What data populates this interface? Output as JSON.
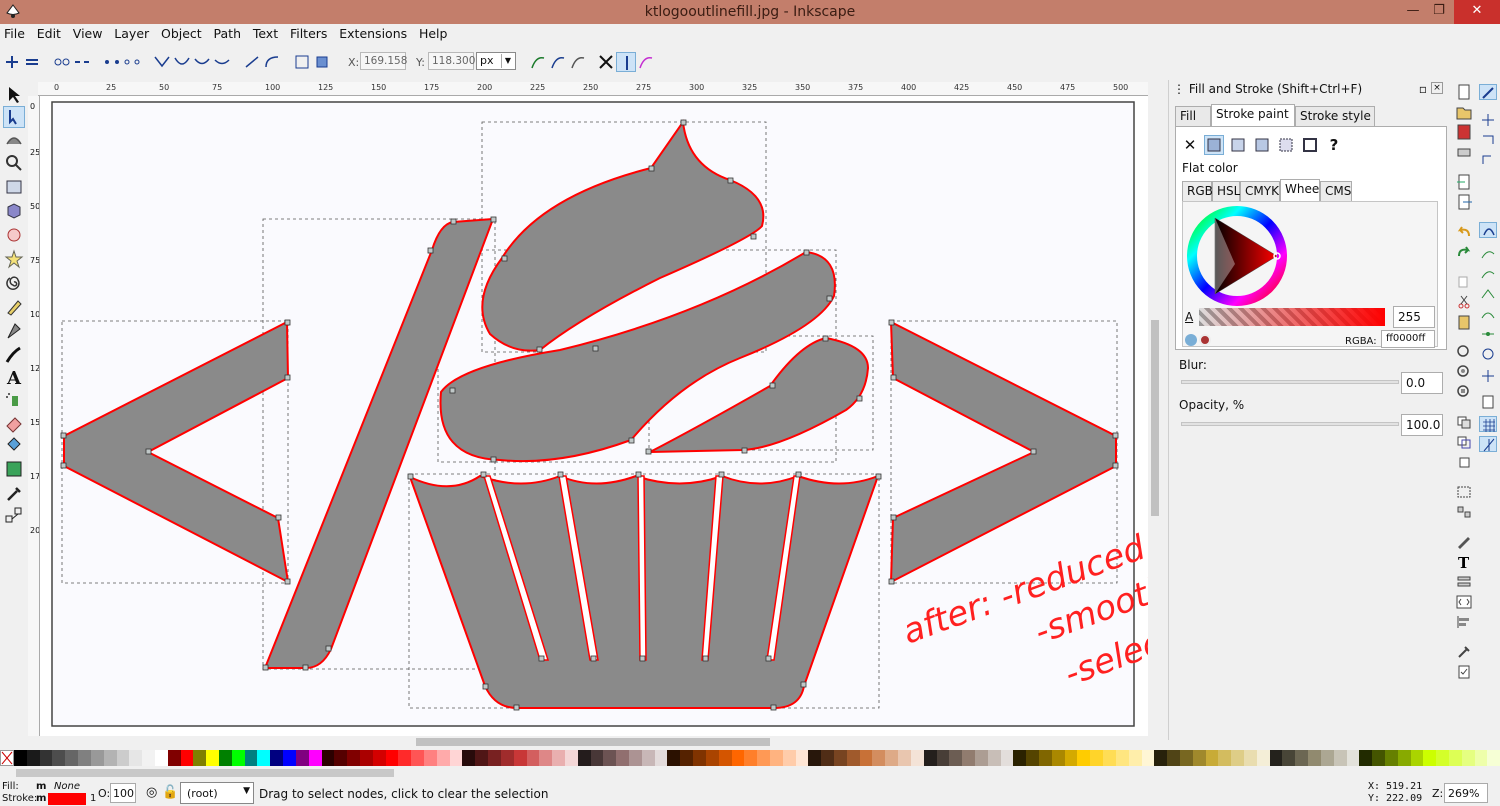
{
  "window": {
    "title": "ktlogooutlinefill.jpg - Inkscape",
    "minimize": "—",
    "maximize": "❐",
    "close": "✕"
  },
  "menu": [
    "File",
    "Edit",
    "View",
    "Layer",
    "Object",
    "Path",
    "Text",
    "Filters",
    "Extensions",
    "Help"
  ],
  "toolcontrols": {
    "x_label": "X:",
    "x_value": "169.158",
    "y_label": "Y:",
    "y_value": "118.300",
    "unit": "px"
  },
  "ruler": {
    "h_ticks": [
      "0",
      "25",
      "50",
      "75",
      "100",
      "125",
      "150",
      "175",
      "200",
      "225",
      "250",
      "275",
      "300",
      "325",
      "350",
      "375",
      "400",
      "425",
      "450",
      "475",
      "500"
    ],
    "v_ticks": [
      "0",
      "25",
      "50",
      "75",
      "100",
      "125",
      "150",
      "175",
      "200"
    ]
  },
  "annotation": {
    "line1": "after: -reduced nodes",
    "line2": "-smooth paths",
    "line3": "-select all"
  },
  "panel": {
    "title": "Fill and Stroke (Shift+Ctrl+F)",
    "tabs": [
      "Fill",
      "Stroke paint",
      "Stroke style"
    ],
    "selected_tab": "Stroke paint",
    "paint_none": "✕",
    "paint_unknown": "?",
    "mode": "Flat color",
    "color_tabs": [
      "RGB",
      "HSL",
      "CMYK",
      "Wheel",
      "CMS"
    ],
    "selected_color_tab": "Wheel",
    "alpha_label": "A",
    "alpha_value": "255",
    "rgba_label": "RGBA:",
    "rgba_value": "ff0000ff",
    "blur_label": "Blur:",
    "blur_value": "0.0",
    "opacity_label": "Opacity, %",
    "opacity_value": "100.0"
  },
  "colors": {
    "stroke": "#ff0000",
    "shape_fill": "#8a8a8a",
    "titlebar": "#c37e6b"
  },
  "status": {
    "fill_label": "Fill:",
    "fill_m": "m",
    "fill_value": "None",
    "stroke_label": "Stroke:",
    "stroke_m": "m",
    "stroke_width": "1",
    "opacity_label": "O:",
    "opacity_value": "100",
    "layer": "(root)",
    "message": "Drag to select nodes, click to clear the selection",
    "x_label": "X:",
    "x_value": "519.21",
    "y_label": "Y:",
    "y_value": "222.09",
    "zoom_label": "Z:",
    "zoom_value": "269%"
  },
  "palette_colors": [
    "#000000",
    "#1a1a1a",
    "#333333",
    "#4d4d4d",
    "#666666",
    "#808080",
    "#999999",
    "#b3b3b3",
    "#cccccc",
    "#e6e6e6",
    "#f2f2f2",
    "#ffffff",
    "#800000",
    "#ff0000",
    "#808000",
    "#ffff00",
    "#008000",
    "#00ff00",
    "#008080",
    "#00ffff",
    "#000080",
    "#0000ff",
    "#800080",
    "#ff00ff",
    "#2b0000",
    "#550000",
    "#800000",
    "#aa0000",
    "#d40000",
    "#ff0000",
    "#ff2a2a",
    "#ff5555",
    "#ff8080",
    "#ffaaaa",
    "#ffd5d5",
    "#280b0b",
    "#501616",
    "#782121",
    "#a02c2c",
    "#c83737",
    "#d35f5f",
    "#de8787",
    "#e9afaf",
    "#f4d7d7",
    "#241c1c",
    "#483737",
    "#6c5353",
    "#916f6f",
    "#ac9393",
    "#c8b7b7",
    "#e3dbdb",
    "#2b1100",
    "#552200",
    "#803300",
    "#aa4400",
    "#d45500",
    "#ff6600",
    "#ff7f2a",
    "#ff9955",
    "#ffb380",
    "#ffccaa",
    "#ffe6d5",
    "#28170b",
    "#502d16",
    "#784421",
    "#a05a2c",
    "#c87137",
    "#d38d5f",
    "#deaa87",
    "#e9c6af",
    "#f4e3d7",
    "#241f1c",
    "#483e37",
    "#6c5d53",
    "#917c6f",
    "#ac9d93",
    "#c8beb7",
    "#e3dedb",
    "#2b2200",
    "#554400",
    "#806600",
    "#aa8800",
    "#d4aa00",
    "#ffcc00",
    "#ffd42a",
    "#ffdd55",
    "#ffe680",
    "#ffeeaa",
    "#fff6d5",
    "#28220b",
    "#504416",
    "#786721",
    "#a0892c",
    "#c8ab37",
    "#d3bc5f",
    "#decd87",
    "#e9ddaf",
    "#f4eed7",
    "#24221c",
    "#484537",
    "#6c6753",
    "#918a6f",
    "#aca793",
    "#c8c4b7",
    "#e3e2db",
    "#222b00",
    "#445500",
    "#668000",
    "#88aa00",
    "#aad400",
    "#ccff00",
    "#d4ff2a",
    "#ddff55",
    "#e5ff80",
    "#eeffaa",
    "#f6ffd5"
  ]
}
